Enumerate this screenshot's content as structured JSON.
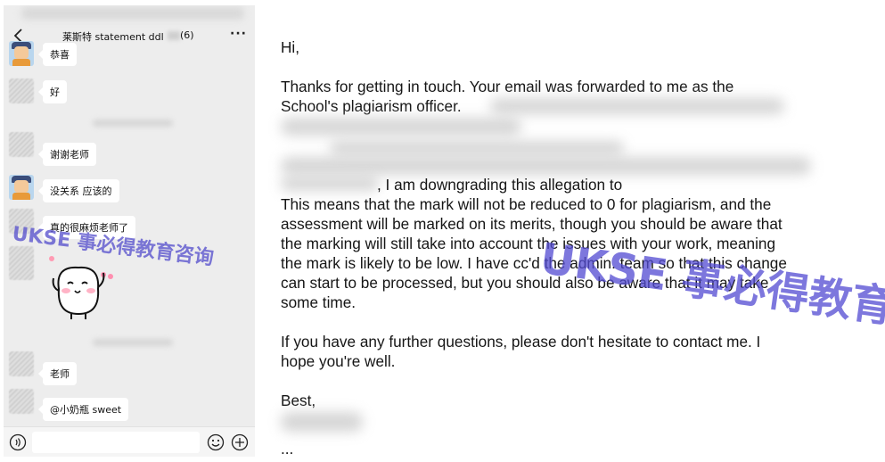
{
  "chat": {
    "title": "莱斯特 statement ddl",
    "member_count": "(6)",
    "back_icon": "chevron-left-icon",
    "more_icon": "ellipsis-icon",
    "messages": [
      {
        "text": "恭喜",
        "avatar": "cartoon"
      },
      {
        "text": "好",
        "avatar": "hatched"
      },
      {
        "text": "谢谢老师",
        "avatar": "hatched"
      },
      {
        "text": "没关系 应该的",
        "avatar": "cartoon"
      },
      {
        "text": "真的很麻烦老师了",
        "avatar": "hatched"
      },
      {
        "text": "老师",
        "avatar": "hatched"
      },
      {
        "text": "@小奶瓶 sweet",
        "avatar": "hatched"
      }
    ],
    "input_bar": {
      "voice_icon": "voice-icon",
      "emoji_icon": "emoji-icon",
      "plus_icon": "plus-icon"
    }
  },
  "email": {
    "greeting": "Hi,",
    "p1_line1": "Thanks for getting in touch.  Your email was forwarded to me as the",
    "p1_line2": "School's plagiarism officer.",
    "p2_line1": ", I am downgrading this allegation to",
    "p2_line2": " This means that the mark will not be reduced to 0 for plagiarism, and the",
    "p2_line3": "assessment will be marked on its merits, though you should be aware that",
    "p2_line4": "the marking will still take into account the issues with your work, meaning",
    "p2_line5": "the mark is likely to be low. I have cc'd the admin. team so that this change",
    "p2_line6": "can start to be processed, but you should also be aware that it may take",
    "p2_line7": "some time.",
    "p3_line1": "If you have any further questions, please don't hesitate to contact me.  I",
    "p3_line2": "hope you're well.",
    "signoff": "Best,",
    "ellipsis": "..."
  },
  "watermark": {
    "text": "UKSE 事必得教育咨询",
    "color": "#5852cd"
  }
}
